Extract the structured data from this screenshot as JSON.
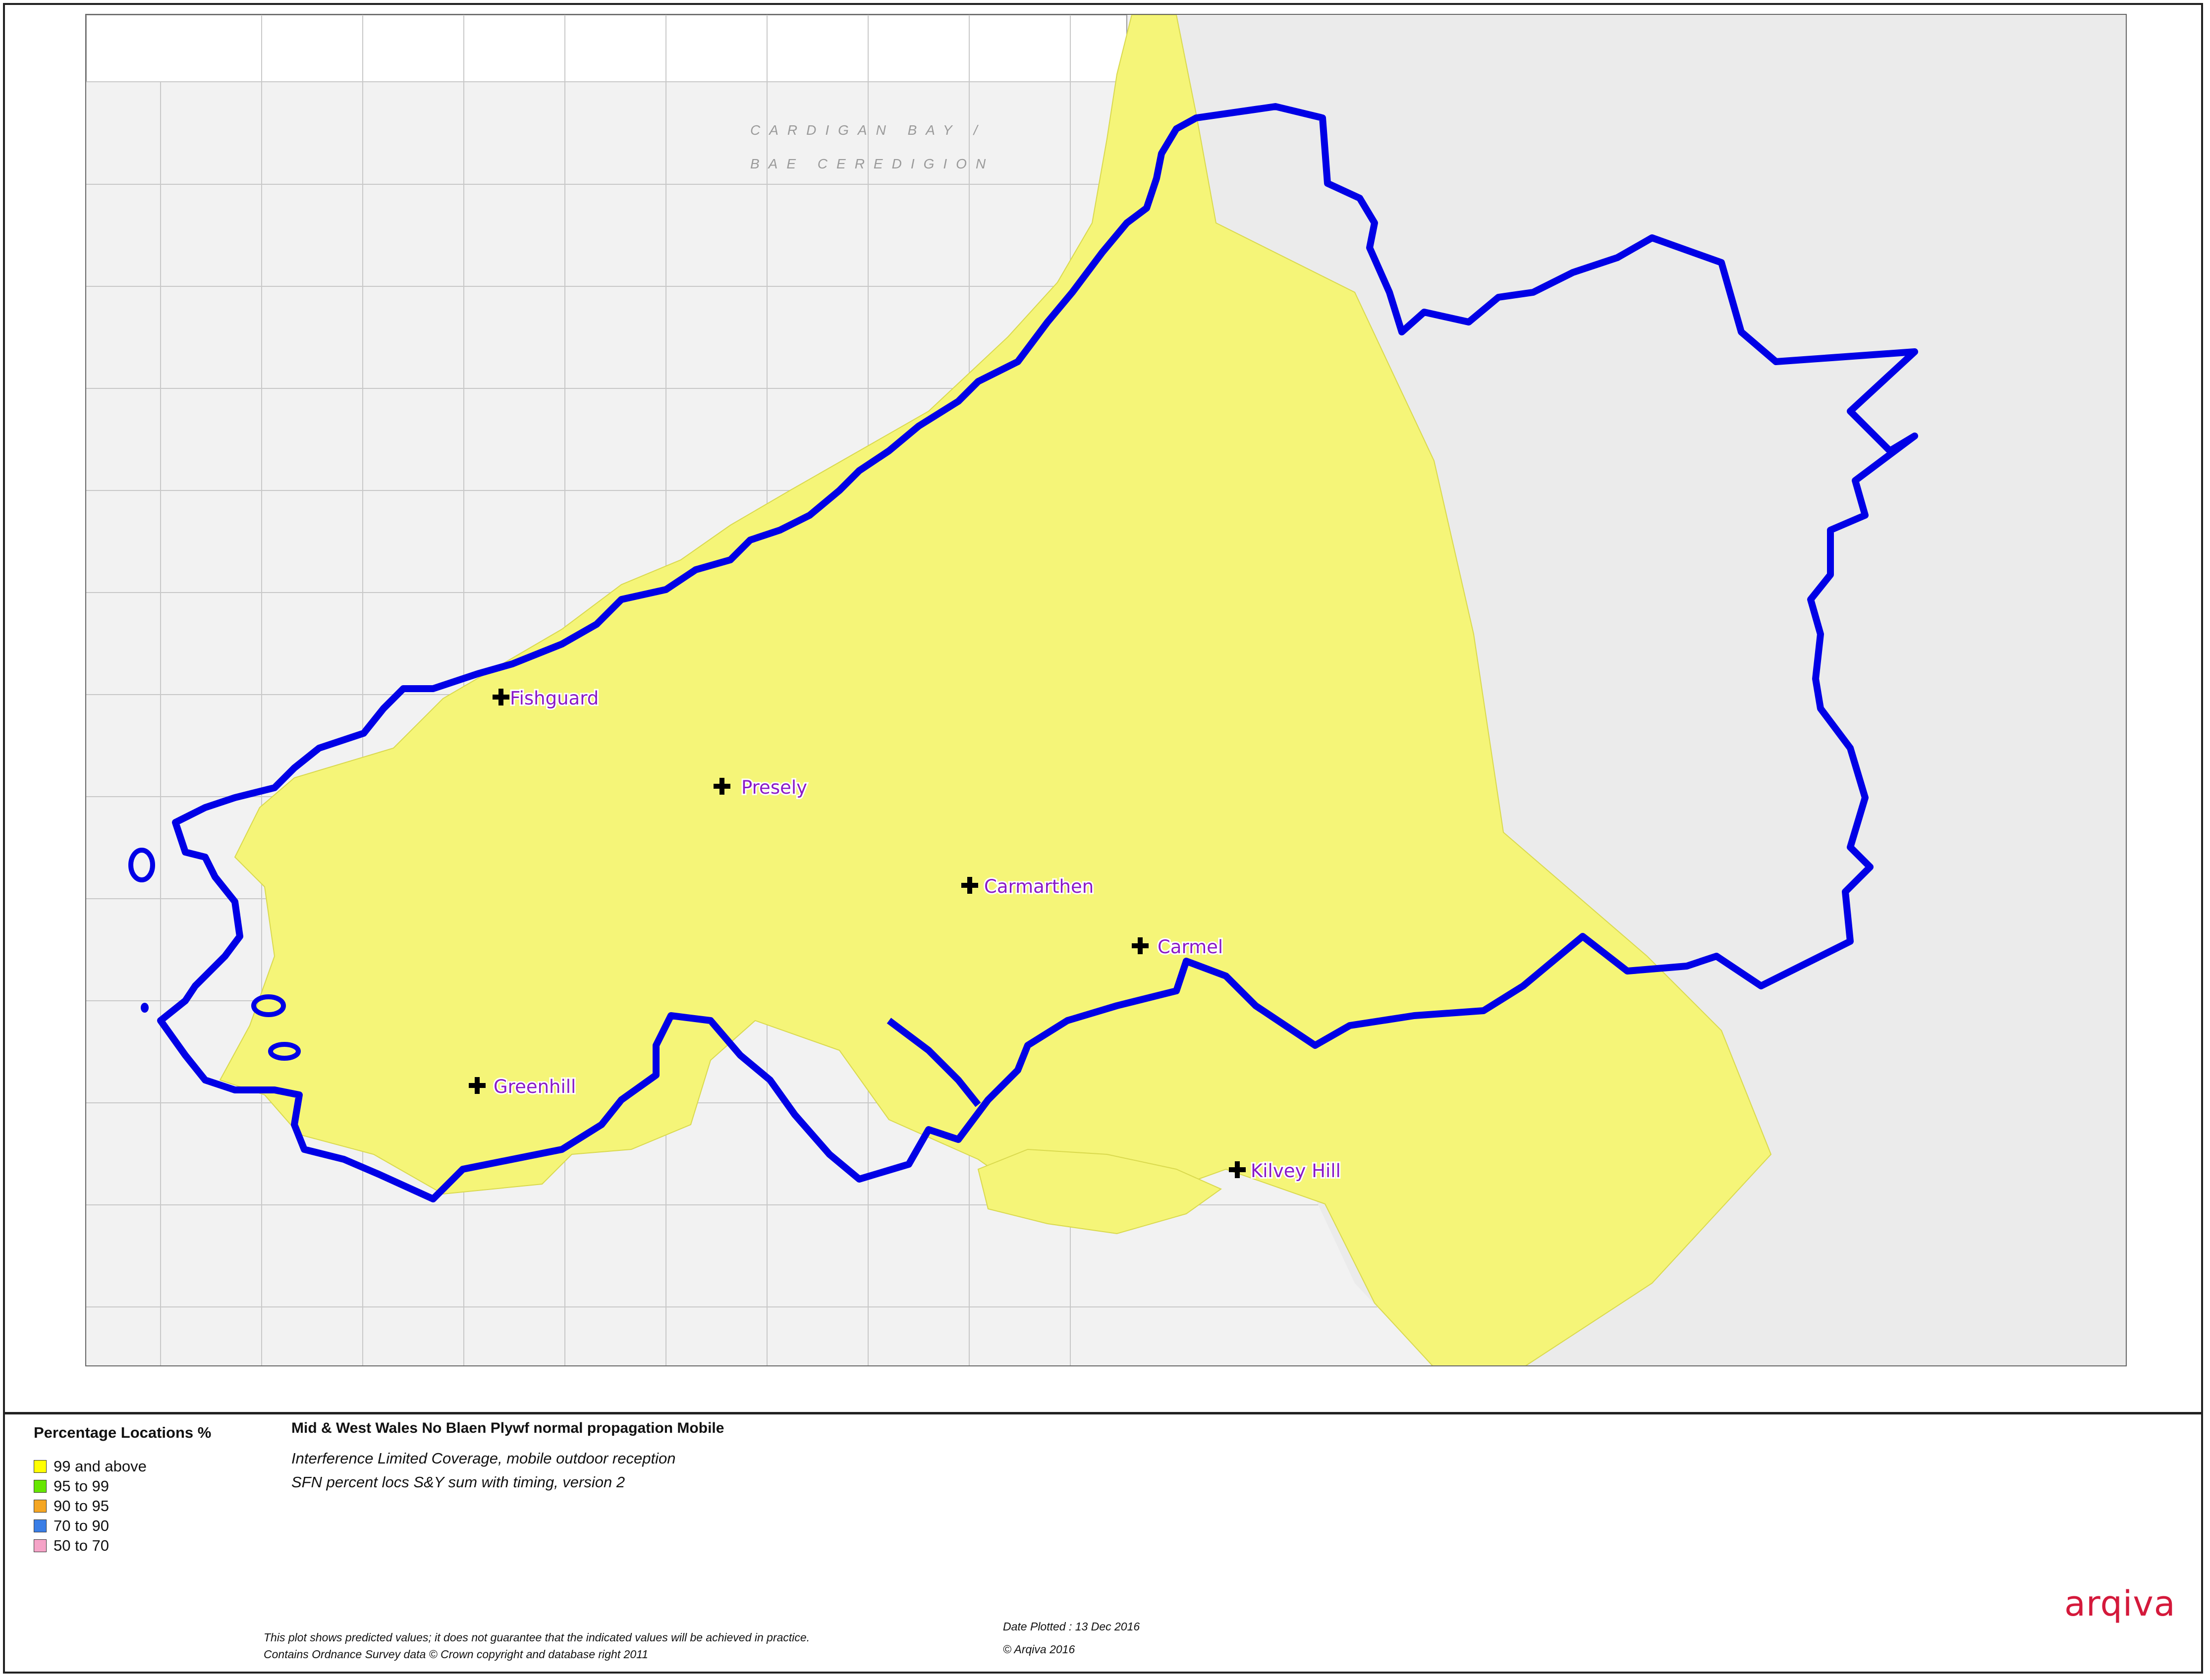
{
  "map": {
    "sea_labels": [
      "CARDIGAN BAY /",
      "BAE CEREDIGION"
    ],
    "transmitters": [
      {
        "name": "Fishguard"
      },
      {
        "name": "Presely"
      },
      {
        "name": "Carmarthen"
      },
      {
        "name": "Carmel"
      },
      {
        "name": "Greenhill"
      },
      {
        "name": "Kilvey Hill"
      }
    ],
    "colors": {
      "coverage": "#f5f578",
      "boundary": "#0000e6",
      "sea": "#f2f2f2",
      "land_uncovered": "#e9e9e9",
      "marker": "#000000",
      "site_label": "#8a18c7"
    }
  },
  "legend": {
    "title": "Percentage Locations %",
    "items": [
      {
        "label": "99 and above",
        "color": "#ffff00"
      },
      {
        "label": "95 to 99",
        "color": "#66e600"
      },
      {
        "label": "90 to 95",
        "color": "#f5a623"
      },
      {
        "label": "70 to 90",
        "color": "#3a7ee6"
      },
      {
        "label": "50 to 70",
        "color": "#f5a3c7"
      }
    ]
  },
  "plot": {
    "title": "Mid & West Wales No Blaen Plywf normal propagation Mobile",
    "subtitle1": "Interference Limited Coverage, mobile outdoor reception",
    "subtitle2": "SFN percent locs S&Y sum with timing, version 2"
  },
  "footer": {
    "disclaimer": "This plot shows predicted values; it does not guarantee that the indicated values will be achieved in practice.",
    "copyright_os": "Contains Ordnance Survey data © Crown copyright and database right 2011",
    "date_plotted": "Date Plotted : 13 Dec 2016",
    "copyright_arqiva": "©  Arqiva 2016"
  },
  "brand": {
    "logo_text": "arqiva",
    "color": "#d4193b"
  }
}
